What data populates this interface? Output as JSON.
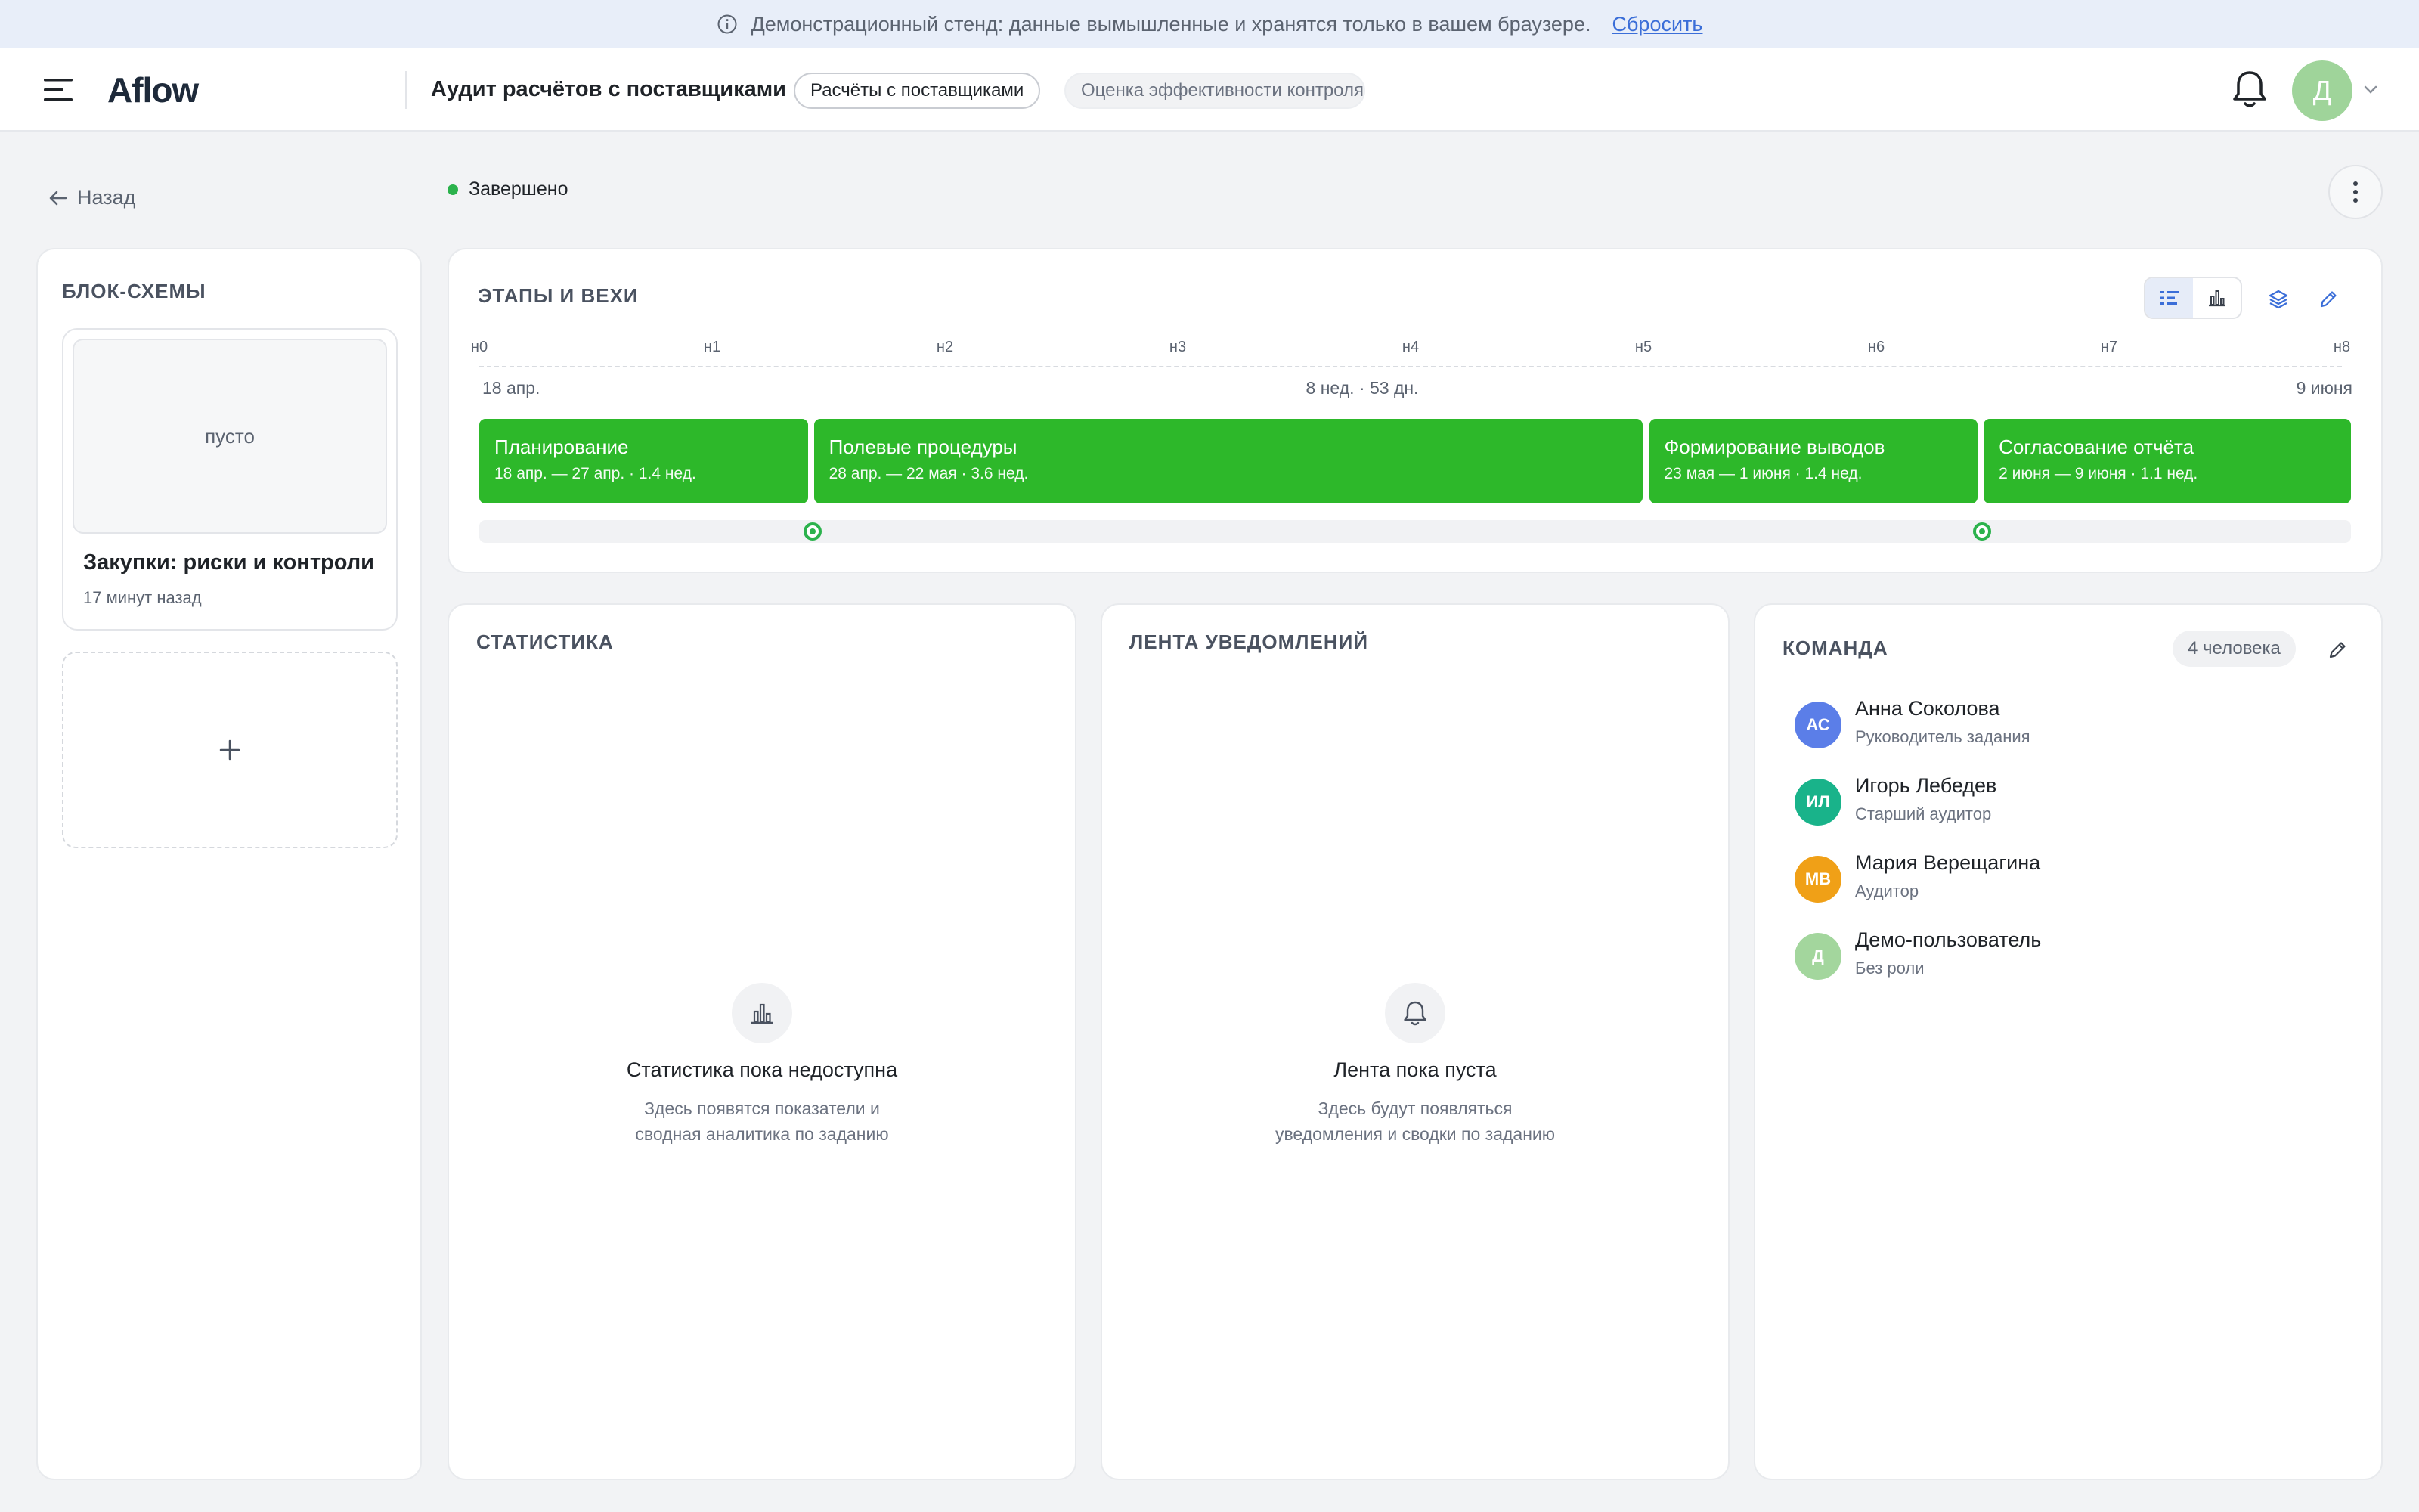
{
  "banner": {
    "text": "Демонстрационный стенд: данные вымышленные и хранятся только в вашем браузере.",
    "reset_label": "Сбросить"
  },
  "header": {
    "logo": "Aflow",
    "page_title": "Аудит расчётов с поставщиками",
    "tags": [
      "Расчёты с поставщиками",
      "Оценка эффективности контроля"
    ],
    "user_initial": "Д"
  },
  "subheader": {
    "back_label": "Назад",
    "status_label": "Завершено",
    "status_color": "#2bb24c"
  },
  "flowcharts": {
    "title": "БЛОК-СХЕМЫ",
    "items": [
      {
        "thumb_label": "пусто",
        "name": "Закупки: риски и контроли",
        "updated": "17 минут назад"
      }
    ],
    "add_label": "+"
  },
  "timeline": {
    "title": "ЭТАПЫ И ВЕХИ",
    "weeks": [
      "н0",
      "н1",
      "н2",
      "н3",
      "н4",
      "н5",
      "н6",
      "н7",
      "н8"
    ],
    "start_date": "18 апр.",
    "duration": "8 нед. · 53 дн.",
    "end_date": "9 июня",
    "phase_color": "#2db82a",
    "phases": [
      {
        "name": "Планирование",
        "dates": "18 апр. — 27 апр. · 1.4 нед.",
        "start_week": 0,
        "end_week": 1.43
      },
      {
        "name": "Полевые процедуры",
        "dates": "28 апр. — 22 мая · 3.6 нед.",
        "start_week": 1.43,
        "end_week": 5.0
      },
      {
        "name": "Формирование выводов",
        "dates": "23 мая — 1 июня · 1.4 нед.",
        "start_week": 5.0,
        "end_week": 6.43
      },
      {
        "name": "Согласование отчёта",
        "dates": "2 июня — 9 июня · 1.1 нед.",
        "start_week": 6.43,
        "end_week": 8.0
      }
    ],
    "milestones": [
      1.43,
      6.43
    ]
  },
  "stats": {
    "title": "СТАТИСТИКА",
    "empty_title": "Статистика пока недоступна",
    "empty_text_1": "Здесь появятся показатели и",
    "empty_text_2": "сводная аналитика по заданию"
  },
  "feed": {
    "title": "ЛЕНТА УВЕДОМЛЕНИЙ",
    "empty_title": "Лента пока пуста",
    "empty_text_1": "Здесь будут появляться",
    "empty_text_2": "уведомления и сводки по заданию"
  },
  "team": {
    "title": "КОМАНДА",
    "count_label": "4 человека",
    "members": [
      {
        "initials": "АС",
        "name": "Анна Соколова",
        "role": "Руководитель задания",
        "color": "#5b7ee8"
      },
      {
        "initials": "ИЛ",
        "name": "Игорь Лебедев",
        "role": "Старший аудитор",
        "color": "#19b38a"
      },
      {
        "initials": "МВ",
        "name": "Мария Верещагина",
        "role": "Аудитор",
        "color": "#f0a017"
      },
      {
        "initials": "Д",
        "name": "Демо-пользователь",
        "role": "Без роли",
        "color": "#a3d69d"
      }
    ]
  }
}
